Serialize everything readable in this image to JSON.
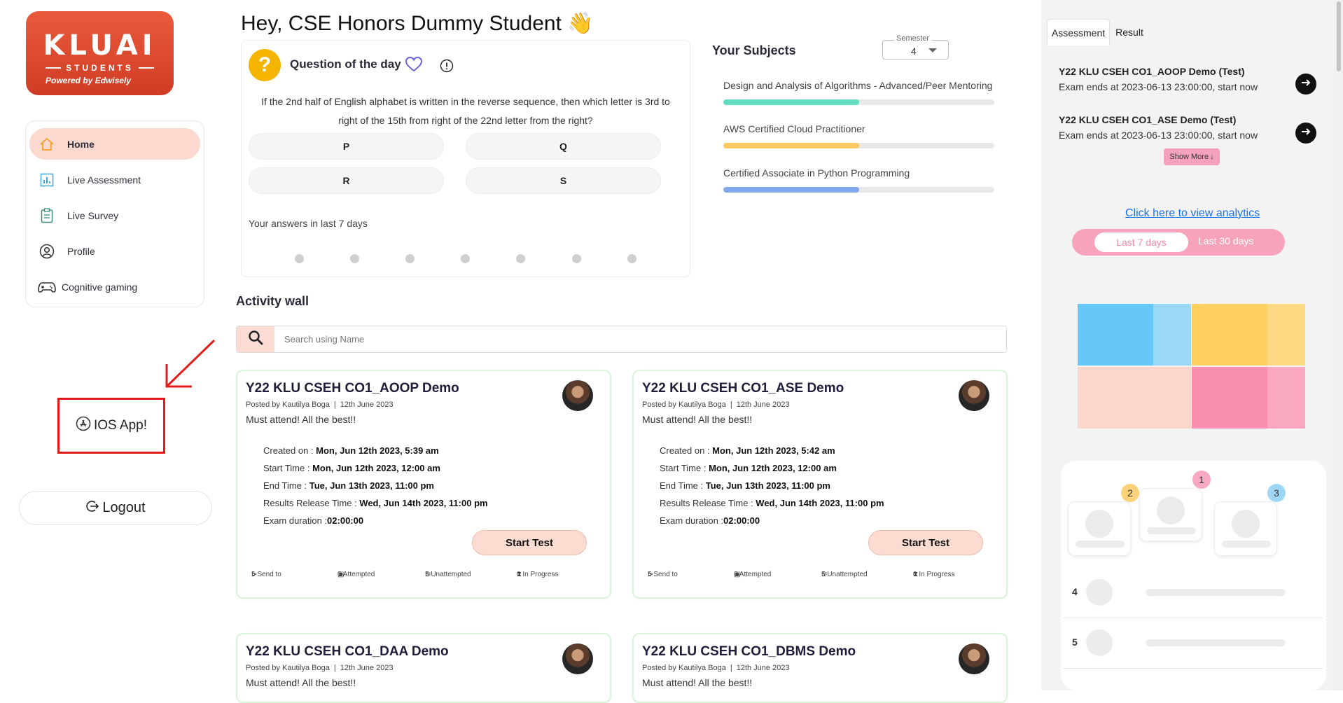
{
  "sidebar": {
    "logo": {
      "main": "KLUAI",
      "sub": "STUDENTS",
      "powered": "Powered by Edwisely"
    },
    "items": [
      {
        "label": "Home",
        "icon": "home-icon",
        "active": true
      },
      {
        "label": "Live Assessment",
        "icon": "chart-icon",
        "active": false
      },
      {
        "label": "Live Survey",
        "icon": "clipboard-icon",
        "active": false
      },
      {
        "label": "Profile",
        "icon": "user-circle-icon",
        "active": false
      },
      {
        "label": "Cognitive gaming",
        "icon": "gamepad-icon",
        "active": false
      }
    ],
    "ios_app": "IOS App!",
    "logout": "Logout"
  },
  "header": {
    "greeting": "Hey, CSE Honors Dummy Student 👋"
  },
  "qotd": {
    "title": "Question of the day",
    "question": "If the 2nd half of English alphabet is written in the reverse sequence, then which letter is 3rd to right of the 15th from right of the 22nd letter from the right?",
    "options": [
      "P",
      "Q",
      "R",
      "S"
    ],
    "last7_label": "Your answers in last 7 days"
  },
  "subjects": {
    "title": "Your Subjects",
    "semester_label": "Semester",
    "semester_value": "4",
    "items": [
      {
        "name": "Design and Analysis of Algorithms - Advanced/Peer Mentoring",
        "progress": 0.5,
        "color": "#63dcc0"
      },
      {
        "name": "AWS Certified Cloud Practitioner",
        "progress": 0.5,
        "color": "#ffc960"
      },
      {
        "name": "Certified Associate in Python Programming",
        "progress": 0.5,
        "color": "#7fa9ea"
      }
    ]
  },
  "activity": {
    "title": "Activity wall",
    "search_placeholder": "Search using Name",
    "labels": {
      "created": "Created on : ",
      "start": "Start Time : ",
      "end": "End Time : ",
      "results": "Results Release Time : ",
      "duration": "Exam duration :",
      "start_button": "Start Test"
    },
    "cards": [
      {
        "title": "Y22 KLU CSEH CO1_AOOP Demo",
        "posted_by": "Posted by Kautilya Boga",
        "date": "12th June 2023",
        "message": "Must attend! All the best!!",
        "created": "Mon, Jun 12th 2023, 5:39 am",
        "start": "Mon, Jun 12th 2023, 12:00 am",
        "end": "Tue, Jun 13th 2023, 11:00 pm",
        "results": "Wed, Jun 14th 2023, 11:00 pm",
        "duration": "02:00:00",
        "sent": "5 Send to",
        "attempted": "0 Attempted",
        "unattempted": "5 Unattempted",
        "in_progress": "0 In Progress"
      },
      {
        "title": "Y22 KLU CSEH CO1_ASE Demo",
        "posted_by": "Posted by Kautilya Boga",
        "date": "12th June 2023",
        "message": "Must attend! All the best!!",
        "created": "Mon, Jun 12th 2023, 5:42 am",
        "start": "Mon, Jun 12th 2023, 12:00 am",
        "end": "Tue, Jun 13th 2023, 11:00 pm",
        "results": "Wed, Jun 14th 2023, 11:00 pm",
        "duration": "02:00:00",
        "sent": "5 Send to",
        "attempted": "0 Attempted",
        "unattempted": "5 Unattempted",
        "in_progress": "0 In Progress"
      },
      {
        "title": "Y22 KLU CSEH CO1_DAA Demo",
        "posted_by": "Posted by Kautilya Boga",
        "date": "12th June 2023",
        "message": "Must attend! All the best!!"
      },
      {
        "title": "Y22 KLU CSEH CO1_DBMS Demo",
        "posted_by": "Posted by Kautilya Boga",
        "date": "12th June 2023",
        "message": "Must attend! All the best!!"
      }
    ]
  },
  "right_panel": {
    "tabs": [
      "Assessment",
      "Result"
    ],
    "items": [
      {
        "title": "Y22 KLU CSEH CO1_AOOP Demo (Test)",
        "subtitle": "Exam ends at 2023-06-13 23:00:00, start now"
      },
      {
        "title": "Y22 KLU CSEH CO1_ASE Demo (Test)",
        "subtitle": "Exam ends at 2023-06-13 23:00:00, start now"
      }
    ],
    "show_more": "Show More",
    "analytics_link": "Click here to view analytics",
    "range_options": [
      "Last 7 days",
      "Last 30 days"
    ],
    "podium_ranks": [
      "2",
      "1",
      "3"
    ],
    "list_ranks": [
      "4",
      "5"
    ]
  }
}
